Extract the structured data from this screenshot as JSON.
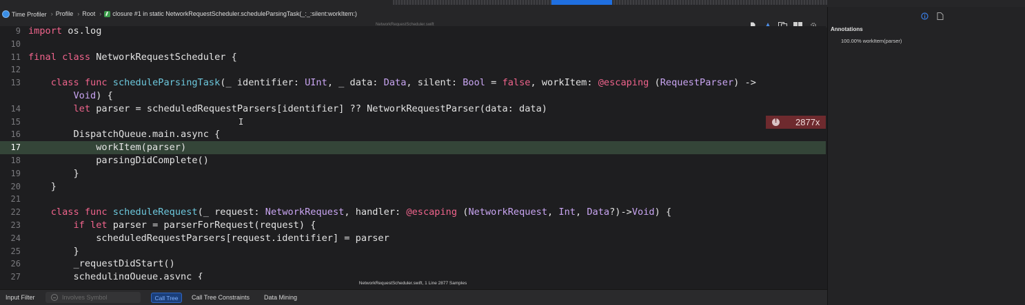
{
  "breadcrumbs": {
    "app": "Time Profiler",
    "profile": "Profile",
    "root": "Root",
    "closure": "closure #1 in static NetworkRequestScheduler.scheduleParsingTask(_:_:silent:workItem:)"
  },
  "editor": {
    "file_title": "NetworkRequestScheduler.swift",
    "status": "NetworkRequestScheduler.swift, 1 Line 2877 Samples",
    "sample_badge": "2877x",
    "lines": [
      {
        "num": "9",
        "code": "import os.log"
      },
      {
        "num": "10",
        "code": ""
      },
      {
        "num": "11",
        "code": "final class NetworkRequestScheduler {"
      },
      {
        "num": "12",
        "code": ""
      },
      {
        "num": "13",
        "code": "    class func scheduleParsingTask(_ identifier: UInt, _ data: Data, silent: Bool = false, workItem: @escaping (RequestParser) ->"
      },
      {
        "num": "",
        "code": "        Void) {"
      },
      {
        "num": "14",
        "code": "        let parser = scheduledRequestParsers[identifier] ?? NetworkRequestParser(data: data)"
      },
      {
        "num": "15",
        "code": ""
      },
      {
        "num": "16",
        "code": "        DispatchQueue.main.async {"
      },
      {
        "num": "17",
        "code": "            workItem(parser)"
      },
      {
        "num": "18",
        "code": "            parsingDidComplete()"
      },
      {
        "num": "19",
        "code": "        }"
      },
      {
        "num": "20",
        "code": "    }"
      },
      {
        "num": "21",
        "code": ""
      },
      {
        "num": "22",
        "code": "    class func scheduleRequest(_ request: NetworkRequest, handler: @escaping (NetworkRequest, Int, Data?)->Void) {"
      },
      {
        "num": "23",
        "code": "        if let parser = parserForRequest(request) {"
      },
      {
        "num": "24",
        "code": "            scheduledRequestParsers[request.identifier] = parser"
      },
      {
        "num": "25",
        "code": "        }"
      },
      {
        "num": "26",
        "code": "        _requestDidStart()"
      },
      {
        "num": "27",
        "code": "        schedulingQueue.async {"
      }
    ]
  },
  "annotations": {
    "title": "Annotations",
    "item": "100.00% workItem(parser)"
  },
  "bottom": {
    "input_filter": "Input Filter",
    "filter_placeholder": "Involves Symbol",
    "call_tree": "Call Tree",
    "call_tree_constraints": "Call Tree Constraints",
    "data_mining": "Data Mining"
  },
  "colors": {
    "accent": "#1f6fe0",
    "keyword": "#f0648c",
    "type": "#c9a5f2",
    "function": "#6dc8dd",
    "highlight_row": "#344538",
    "sample_badge": "#6e2a2e"
  }
}
